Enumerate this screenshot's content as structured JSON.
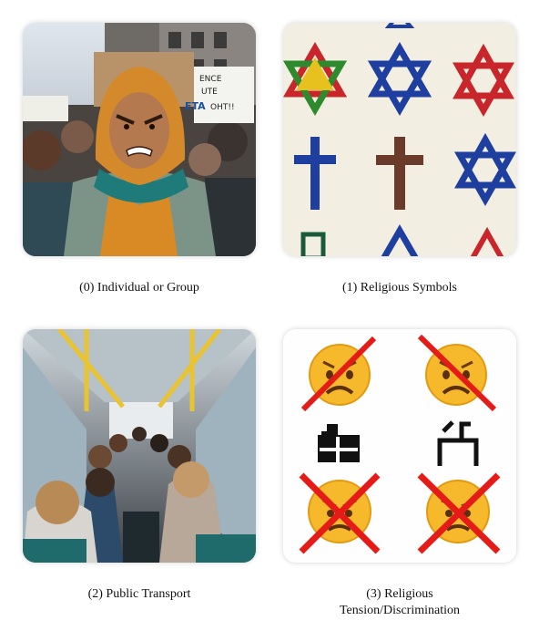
{
  "panels": [
    {
      "caption": "(0) Individual or Group",
      "image": "angry protester in orange hood in crowd with cardboard signs",
      "sign_text": [
        "ENCE",
        "UTE",
        "ETA",
        "OHT!!"
      ]
    },
    {
      "caption": "(1) Religious Symbols",
      "image": "embroidered stars of David and crosses on cream fabric"
    },
    {
      "caption": "(2) Public Transport",
      "image": "interior of crowded bus with passengers seen from behind"
    },
    {
      "caption_line1": "(3) Religious",
      "caption_line2": "Tension/Discrimination",
      "image": "crossed-out sad emoji faces with abstract glyph symbols"
    }
  ],
  "colors": {
    "cross_red": "#e41b17",
    "emoji_yellow": "#f6b92b",
    "star_blue": "#1f3fa0",
    "star_red": "#c8262b",
    "bus_yellow": "#e9c430"
  }
}
